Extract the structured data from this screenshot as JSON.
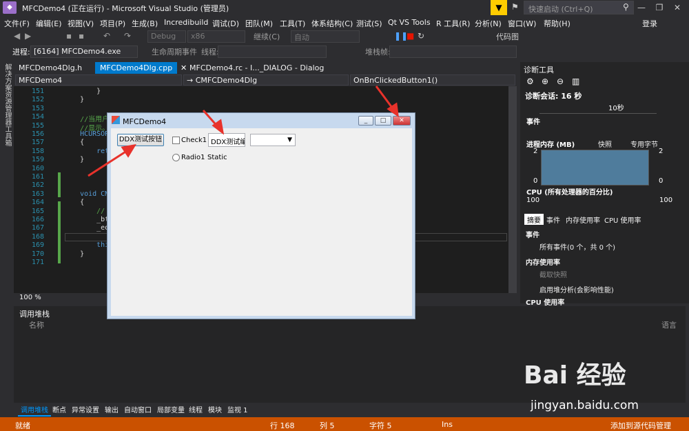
{
  "window": {
    "title": "MFCDemo4 (正在运行) - Microsoft Visual Studio (管理员)",
    "quick_launch_placeholder": "快速启动 (Ctrl+Q)",
    "signin": "登录"
  },
  "menu": [
    "文件(F)",
    "编辑(E)",
    "视图(V)",
    "项目(P)",
    "生成(B)",
    "Incredibuild",
    "调试(D)",
    "团队(M)",
    "工具(T)",
    "体系结构(C)",
    "测试(S)",
    "Qt VS Tools",
    "R 工具(R)",
    "分析(N)",
    "窗口(W)",
    "帮助(H)"
  ],
  "toolbar": {
    "config": "Debug",
    "platform": "x86",
    "continue": "继续(C)",
    "auto": "自动",
    "codemap": "代码图"
  },
  "procbar": {
    "label": "进程:",
    "process": "[6164] MFCDemo4.exe",
    "lifecycle": "生命周期事件",
    "thread": "线程:",
    "stackframe": "堆栈帧:"
  },
  "side_tabs": [
    "解决方案资源管理器",
    "工具箱"
  ],
  "doc_tabs": [
    "MFCDemo4Dlg.h",
    "MFCDemo4Dlg.cpp",
    "MFCDemo4.rc - I..._DIALOG - Dialog"
  ],
  "nav": {
    "project": "MFCDemo4",
    "class": "→ CMFCDemo4Dlg",
    "member": "OnBnClickedButton1()"
  },
  "editor": {
    "lines": [
      "151",
      "152",
      "153",
      "154",
      "155",
      "156",
      "157",
      "158",
      "159",
      "160",
      "161",
      "162",
      "163",
      "164",
      "165",
      "166",
      "167",
      "168",
      "169",
      "170",
      "171"
    ],
    "code": [
      "        }",
      "    }",
      "",
      "    //当用户拖动",
      "    //显示。",
      "    HCURSOR CMF",
      "    {",
      "        return",
      "    }",
      "",
      "",
      "",
      "    void CMFCDe",
      "    {",
      "        // TODO",
      "        _btnCap",
      "        _edtCap",
      "",
      "        this->U",
      "    }",
      ""
    ],
    "zoom": "100 %"
  },
  "diag": {
    "title": "诊断工具",
    "session": "诊断会话: 16 秒",
    "tick": "10秒",
    "events": "事件",
    "process_memory": "进程内存 (MB)",
    "snapshot": "快照",
    "private_bytes": "专用字节",
    "mem_max": "2",
    "mem_min": "0",
    "cpu": "CPU (所有处理器的百分比)",
    "cpu_max": "100",
    "tabs": [
      "摘要",
      "事件",
      "内存使用率",
      "CPU 使用率"
    ],
    "panel": {
      "events_head": "事件",
      "all_events": "所有事件(0 个，共 0 个)",
      "mem_head": "内存使用率",
      "take_snapshot": "截取快照",
      "heap": "启用堆分析(会影响性能)",
      "cpu_head": "CPU 使用率"
    }
  },
  "callstack": {
    "title": "调用堆栈",
    "name_col": "名称",
    "lang_col": "语言"
  },
  "bottom_tabs": [
    "调用堆栈",
    "断点",
    "异常设置",
    "输出",
    "自动窗口",
    "局部变量",
    "线程",
    "模块",
    "监视 1"
  ],
  "status": {
    "ready": "就绪",
    "line": "行 168",
    "col": "列 5",
    "char": "字符 5",
    "mode": "Ins",
    "source": "添加到源代码管理"
  },
  "dialog": {
    "title": "MFCDemo4",
    "button": "DDX测试按钮",
    "check": "Check1",
    "edit": "DDX测试编辑",
    "radio": "Radio1",
    "static": "Static"
  },
  "watermark": {
    "brand": "Bai 经验",
    "url": "jingyan.baidu.com"
  }
}
